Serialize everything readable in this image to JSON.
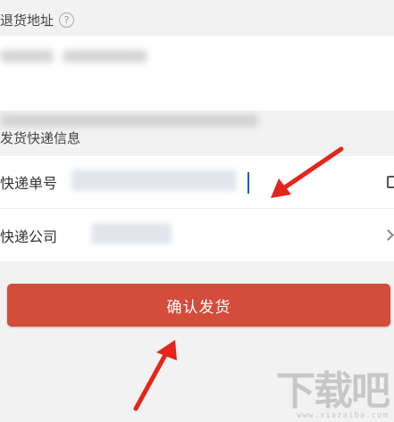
{
  "return_address": {
    "label": "退货地址",
    "help_icon": "?"
  },
  "shipping_info": {
    "label": "发货快递信息",
    "tracking_number": {
      "label": "快递单号",
      "trailing_icon": "scan-icon"
    },
    "courier_company": {
      "label": "快递公司",
      "trailing_icon": "chevron-right-icon"
    }
  },
  "confirm_button": {
    "label": "确认发货"
  },
  "watermark": {
    "logo": "下载吧",
    "url": "www.xiazaiba.com"
  },
  "colors": {
    "accent": "#d44c3b",
    "annotation_arrow": "#e3251b",
    "background": "#f2f2f2"
  }
}
